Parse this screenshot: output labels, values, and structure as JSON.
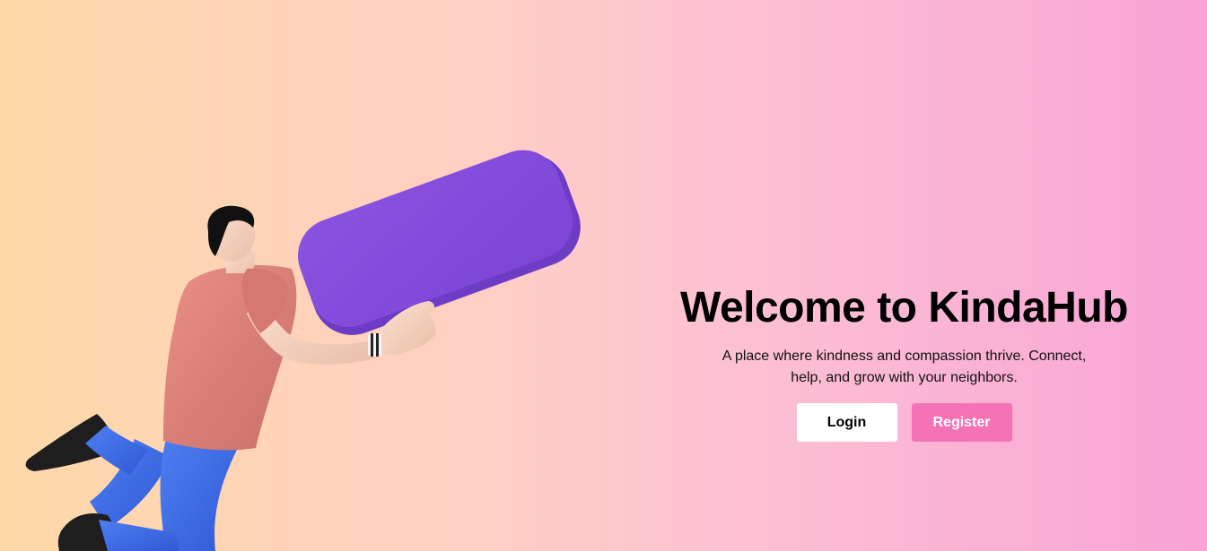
{
  "hero": {
    "title": "Welcome to KindaHub",
    "subtitle": "A place where kindness and compassion thrive. Connect, help, and grow with your neighbors.",
    "login_label": "Login",
    "register_label": "Register",
    "illustration_icon": "person-holding-speech-bubble-illustration"
  },
  "colors": {
    "gradient_start": "#fed9a8",
    "gradient_end": "#f8a4d6",
    "register_button": "#f472b6",
    "login_button": "#ffffff",
    "bubble": "#8650dc"
  }
}
